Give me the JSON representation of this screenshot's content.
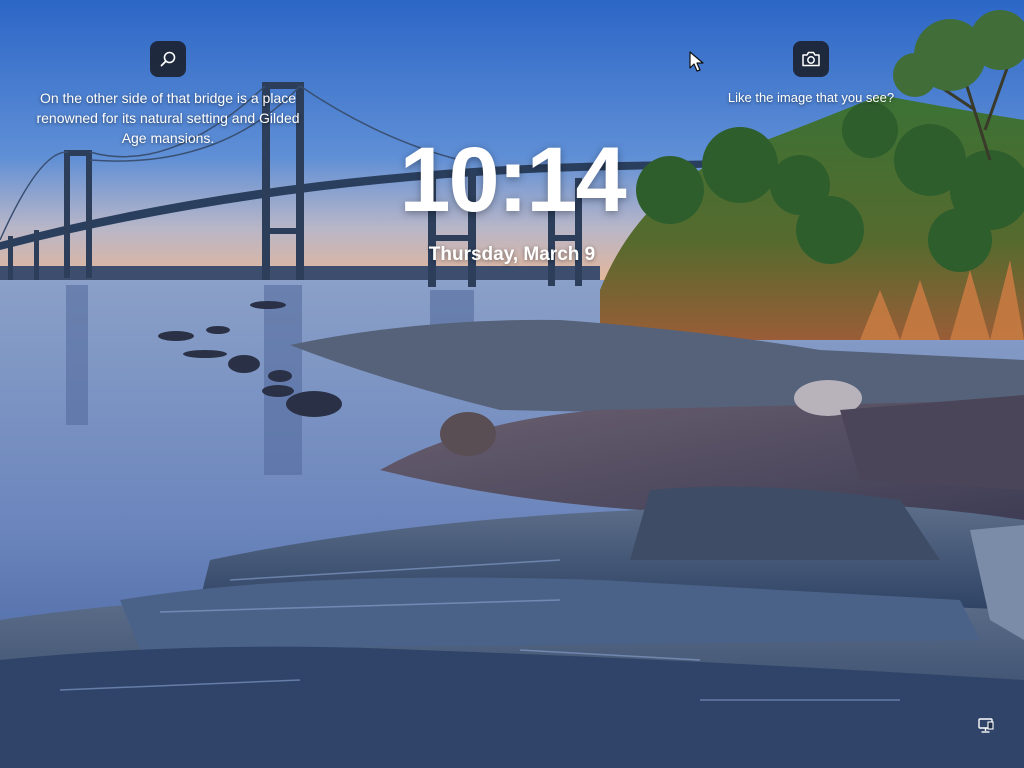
{
  "lock_screen": {
    "time": "10:14",
    "date": "Thursday, March 9"
  },
  "spotlight": {
    "search": {
      "icon": "search-icon",
      "caption": "On the other side of that bridge is a place renowned for its natural setting and Gilded Age mansions."
    },
    "feedback": {
      "icon": "camera-icon",
      "caption": "Like the image that you see?"
    }
  },
  "status": {
    "network_icon": "network-icon"
  },
  "colors": {
    "sky_top": "#2f6fd1",
    "sky_horizon": "#e6b89a",
    "water": "#6f86b8",
    "rock": "#38506e",
    "foliage": "#3f7a3a",
    "dry_grass": "#c77b42"
  }
}
